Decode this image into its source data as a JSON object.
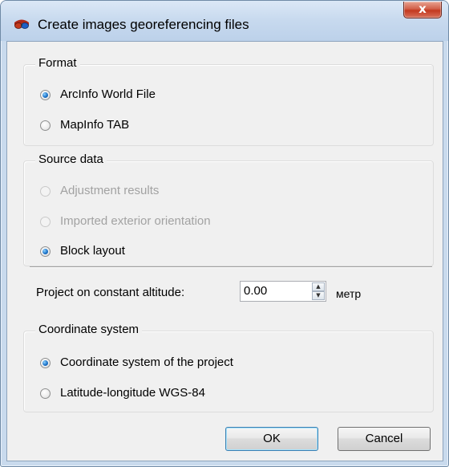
{
  "window": {
    "title": "Create images georeferencing files",
    "close_label": "x"
  },
  "format": {
    "title": "Format",
    "options": [
      {
        "label": "ArcInfo World File",
        "checked": true,
        "enabled": true
      },
      {
        "label": "MapInfo TAB",
        "checked": false,
        "enabled": true
      }
    ]
  },
  "source": {
    "title": "Source data",
    "options": [
      {
        "label": "Adjustment results",
        "checked": false,
        "enabled": false
      },
      {
        "label": "Imported exterior orientation",
        "checked": false,
        "enabled": false
      },
      {
        "label": "Block layout",
        "checked": true,
        "enabled": true
      }
    ]
  },
  "altitude": {
    "label": "Project on constant altitude:",
    "value": "0.00",
    "unit": "метр"
  },
  "coords": {
    "title": "Coordinate system",
    "options": [
      {
        "label": "Coordinate system of the project",
        "checked": true,
        "enabled": true
      },
      {
        "label": "Latitude-longitude WGS-84",
        "checked": false,
        "enabled": true
      }
    ]
  },
  "buttons": {
    "ok": "OK",
    "cancel": "Cancel"
  },
  "icons": {
    "app": "glasses-icon",
    "close": "close-icon"
  }
}
